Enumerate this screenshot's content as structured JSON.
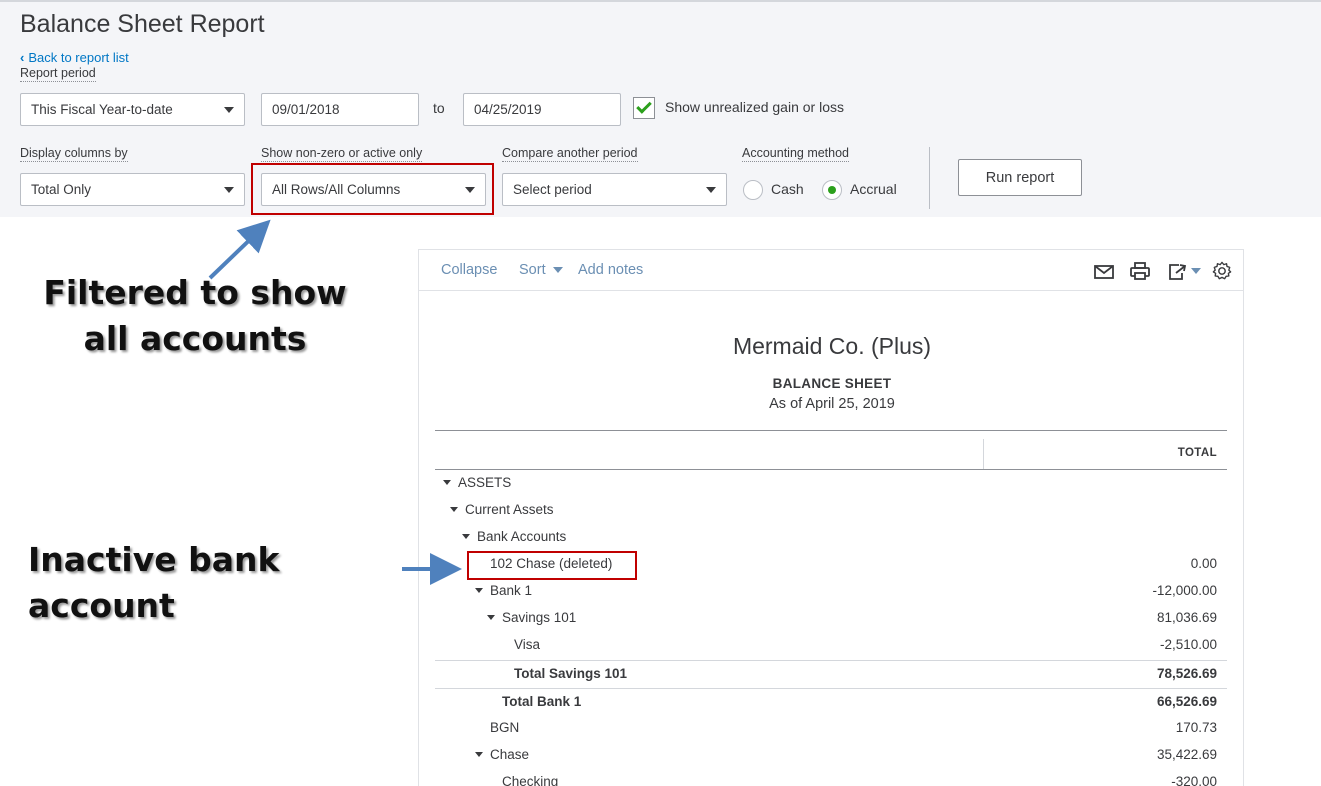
{
  "header": {
    "title": "Balance Sheet Report",
    "back_link": "Back to report list"
  },
  "filters": {
    "report_period_label": "Report period",
    "report_period_value": "This Fiscal Year-to-date",
    "start_date": "09/01/2018",
    "to_label": "to",
    "end_date": "04/25/2019",
    "unrealized_label": "Show unrealized gain or loss",
    "unrealized_checked": true,
    "display_columns_label": "Display columns by",
    "display_columns_value": "Total Only",
    "nonzero_label": "Show non-zero or active only",
    "nonzero_value": "All Rows/All Columns",
    "compare_label": "Compare another period",
    "compare_value": "Select period",
    "accounting_label": "Accounting method",
    "cash_label": "Cash",
    "accrual_label": "Accrual",
    "selected_method": "Accrual",
    "run_button": "Run report"
  },
  "toolbar": {
    "collapse": "Collapse",
    "sort": "Sort",
    "add_notes": "Add notes",
    "icons": [
      "email-icon",
      "print-icon",
      "export-icon",
      "settings-icon"
    ]
  },
  "report": {
    "company": "Mermaid Co. (Plus)",
    "title": "BALANCE SHEET",
    "as_of": "As of April 25, 2019",
    "column_header": "TOTAL",
    "rows": [
      {
        "label": "ASSETS",
        "amount": "",
        "indent": 0,
        "expand": true,
        "total": false
      },
      {
        "label": "Current Assets",
        "amount": "",
        "indent": 1,
        "expand": true,
        "total": false
      },
      {
        "label": "Bank Accounts",
        "amount": "",
        "indent": 2,
        "expand": true,
        "total": false
      },
      {
        "label": "102 Chase (deleted)",
        "amount": "0.00",
        "indent": 3,
        "expand": false,
        "total": false
      },
      {
        "label": "Bank 1",
        "amount": "-12,000.00",
        "indent": 3,
        "expand": true,
        "total": false
      },
      {
        "label": "Savings 101",
        "amount": "81,036.69",
        "indent": 4,
        "expand": true,
        "total": false
      },
      {
        "label": "Visa",
        "amount": "-2,510.00",
        "indent": 5,
        "expand": false,
        "total": false
      },
      {
        "label": "Total Savings 101",
        "amount": "78,526.69",
        "indent": 5,
        "expand": false,
        "total": true
      },
      {
        "label": "Total Bank 1",
        "amount": "66,526.69",
        "indent": 4,
        "expand": false,
        "total": true
      },
      {
        "label": "BGN",
        "amount": "170.73",
        "indent": 3,
        "expand": false,
        "total": false
      },
      {
        "label": "Chase",
        "amount": "35,422.69",
        "indent": 3,
        "expand": true,
        "total": false
      },
      {
        "label": "Checking",
        "amount": "-320.00",
        "indent": 4,
        "expand": false,
        "total": false
      }
    ]
  },
  "annotations": {
    "filter_note_line1": "Filtered to show",
    "filter_note_line2": "all accounts",
    "inactive_note": "Inactive bank account"
  },
  "colors": {
    "highlight": "#c00000",
    "arrow": "#4f81bd",
    "link": "#0077c5",
    "check": "#2ca01c"
  }
}
